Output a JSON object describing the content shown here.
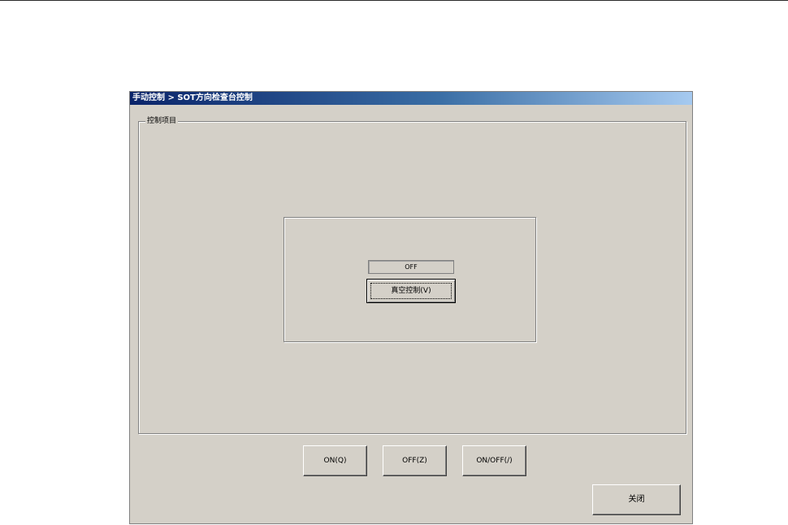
{
  "window": {
    "title": "手动控制 > SOT方向检查台控制"
  },
  "group": {
    "legend": "控制项目"
  },
  "vacuum": {
    "status": "OFF",
    "button_label": "真空控制(V)"
  },
  "actions": {
    "on_label": "ON(Q)",
    "off_label": "OFF(Z)",
    "onoff_label": "ON/OFF(/)"
  },
  "footer": {
    "close_label": "关闭"
  }
}
